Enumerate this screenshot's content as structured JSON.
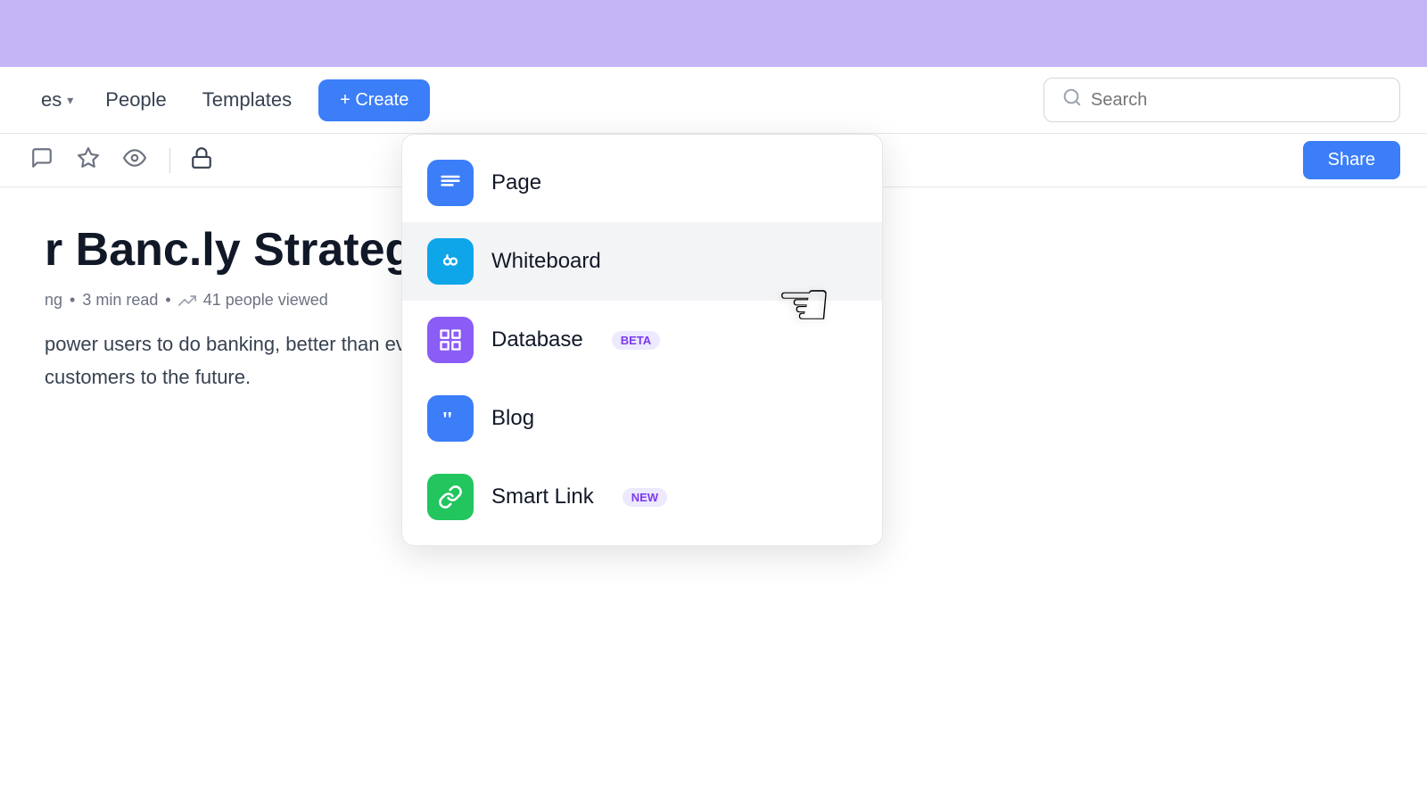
{
  "banner": {
    "color": "#c4b5f7"
  },
  "navbar": {
    "spaces_label": "es",
    "people_label": "People",
    "templates_label": "Templates",
    "create_label": "+ Create",
    "search_placeholder": "Search"
  },
  "toolbar": {
    "share_label": "Share"
  },
  "page": {
    "title": "r Banc.ly Strategy",
    "meta_author": "ng",
    "meta_read_time": "3 min read",
    "meta_views": "41 people viewed",
    "body_text": "power users to do banking, better than ever. We are a credit card company to take our customers to the future."
  },
  "dropdown": {
    "items": [
      {
        "id": "page",
        "label": "Page",
        "icon": "page",
        "badge": null
      },
      {
        "id": "whiteboard",
        "label": "Whiteboard",
        "icon": "whiteboard",
        "badge": null
      },
      {
        "id": "database",
        "label": "Database",
        "icon": "database",
        "badge": "BETA"
      },
      {
        "id": "blog",
        "label": "Blog",
        "icon": "blog",
        "badge": null
      },
      {
        "id": "smartlink",
        "label": "Smart Link",
        "icon": "smartlink",
        "badge": "NEW"
      }
    ]
  }
}
